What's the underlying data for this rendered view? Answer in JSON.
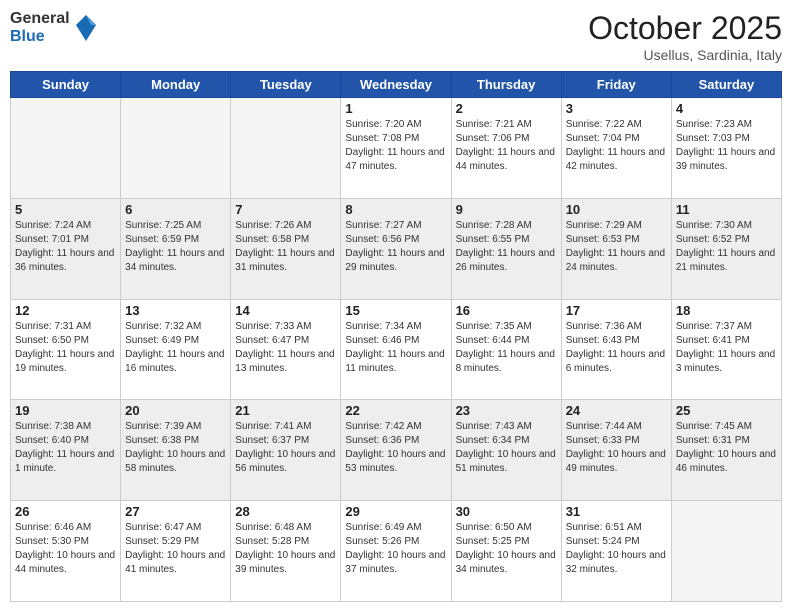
{
  "logo": {
    "general": "General",
    "blue": "Blue"
  },
  "title": "October 2025",
  "subtitle": "Usellus, Sardinia, Italy",
  "weekdays": [
    "Sunday",
    "Monday",
    "Tuesday",
    "Wednesday",
    "Thursday",
    "Friday",
    "Saturday"
  ],
  "weeks": [
    [
      {
        "day": "",
        "info": ""
      },
      {
        "day": "",
        "info": ""
      },
      {
        "day": "",
        "info": ""
      },
      {
        "day": "1",
        "info": "Sunrise: 7:20 AM\nSunset: 7:08 PM\nDaylight: 11 hours\nand 47 minutes."
      },
      {
        "day": "2",
        "info": "Sunrise: 7:21 AM\nSunset: 7:06 PM\nDaylight: 11 hours\nand 44 minutes."
      },
      {
        "day": "3",
        "info": "Sunrise: 7:22 AM\nSunset: 7:04 PM\nDaylight: 11 hours\nand 42 minutes."
      },
      {
        "day": "4",
        "info": "Sunrise: 7:23 AM\nSunset: 7:03 PM\nDaylight: 11 hours\nand 39 minutes."
      }
    ],
    [
      {
        "day": "5",
        "info": "Sunrise: 7:24 AM\nSunset: 7:01 PM\nDaylight: 11 hours\nand 36 minutes."
      },
      {
        "day": "6",
        "info": "Sunrise: 7:25 AM\nSunset: 6:59 PM\nDaylight: 11 hours\nand 34 minutes."
      },
      {
        "day": "7",
        "info": "Sunrise: 7:26 AM\nSunset: 6:58 PM\nDaylight: 11 hours\nand 31 minutes."
      },
      {
        "day": "8",
        "info": "Sunrise: 7:27 AM\nSunset: 6:56 PM\nDaylight: 11 hours\nand 29 minutes."
      },
      {
        "day": "9",
        "info": "Sunrise: 7:28 AM\nSunset: 6:55 PM\nDaylight: 11 hours\nand 26 minutes."
      },
      {
        "day": "10",
        "info": "Sunrise: 7:29 AM\nSunset: 6:53 PM\nDaylight: 11 hours\nand 24 minutes."
      },
      {
        "day": "11",
        "info": "Sunrise: 7:30 AM\nSunset: 6:52 PM\nDaylight: 11 hours\nand 21 minutes."
      }
    ],
    [
      {
        "day": "12",
        "info": "Sunrise: 7:31 AM\nSunset: 6:50 PM\nDaylight: 11 hours\nand 19 minutes."
      },
      {
        "day": "13",
        "info": "Sunrise: 7:32 AM\nSunset: 6:49 PM\nDaylight: 11 hours\nand 16 minutes."
      },
      {
        "day": "14",
        "info": "Sunrise: 7:33 AM\nSunset: 6:47 PM\nDaylight: 11 hours\nand 13 minutes."
      },
      {
        "day": "15",
        "info": "Sunrise: 7:34 AM\nSunset: 6:46 PM\nDaylight: 11 hours\nand 11 minutes."
      },
      {
        "day": "16",
        "info": "Sunrise: 7:35 AM\nSunset: 6:44 PM\nDaylight: 11 hours\nand 8 minutes."
      },
      {
        "day": "17",
        "info": "Sunrise: 7:36 AM\nSunset: 6:43 PM\nDaylight: 11 hours\nand 6 minutes."
      },
      {
        "day": "18",
        "info": "Sunrise: 7:37 AM\nSunset: 6:41 PM\nDaylight: 11 hours\nand 3 minutes."
      }
    ],
    [
      {
        "day": "19",
        "info": "Sunrise: 7:38 AM\nSunset: 6:40 PM\nDaylight: 11 hours\nand 1 minute."
      },
      {
        "day": "20",
        "info": "Sunrise: 7:39 AM\nSunset: 6:38 PM\nDaylight: 10 hours\nand 58 minutes."
      },
      {
        "day": "21",
        "info": "Sunrise: 7:41 AM\nSunset: 6:37 PM\nDaylight: 10 hours\nand 56 minutes."
      },
      {
        "day": "22",
        "info": "Sunrise: 7:42 AM\nSunset: 6:36 PM\nDaylight: 10 hours\nand 53 minutes."
      },
      {
        "day": "23",
        "info": "Sunrise: 7:43 AM\nSunset: 6:34 PM\nDaylight: 10 hours\nand 51 minutes."
      },
      {
        "day": "24",
        "info": "Sunrise: 7:44 AM\nSunset: 6:33 PM\nDaylight: 10 hours\nand 49 minutes."
      },
      {
        "day": "25",
        "info": "Sunrise: 7:45 AM\nSunset: 6:31 PM\nDaylight: 10 hours\nand 46 minutes."
      }
    ],
    [
      {
        "day": "26",
        "info": "Sunrise: 6:46 AM\nSunset: 5:30 PM\nDaylight: 10 hours\nand 44 minutes."
      },
      {
        "day": "27",
        "info": "Sunrise: 6:47 AM\nSunset: 5:29 PM\nDaylight: 10 hours\nand 41 minutes."
      },
      {
        "day": "28",
        "info": "Sunrise: 6:48 AM\nSunset: 5:28 PM\nDaylight: 10 hours\nand 39 minutes."
      },
      {
        "day": "29",
        "info": "Sunrise: 6:49 AM\nSunset: 5:26 PM\nDaylight: 10 hours\nand 37 minutes."
      },
      {
        "day": "30",
        "info": "Sunrise: 6:50 AM\nSunset: 5:25 PM\nDaylight: 10 hours\nand 34 minutes."
      },
      {
        "day": "31",
        "info": "Sunrise: 6:51 AM\nSunset: 5:24 PM\nDaylight: 10 hours\nand 32 minutes."
      },
      {
        "day": "",
        "info": ""
      }
    ]
  ]
}
